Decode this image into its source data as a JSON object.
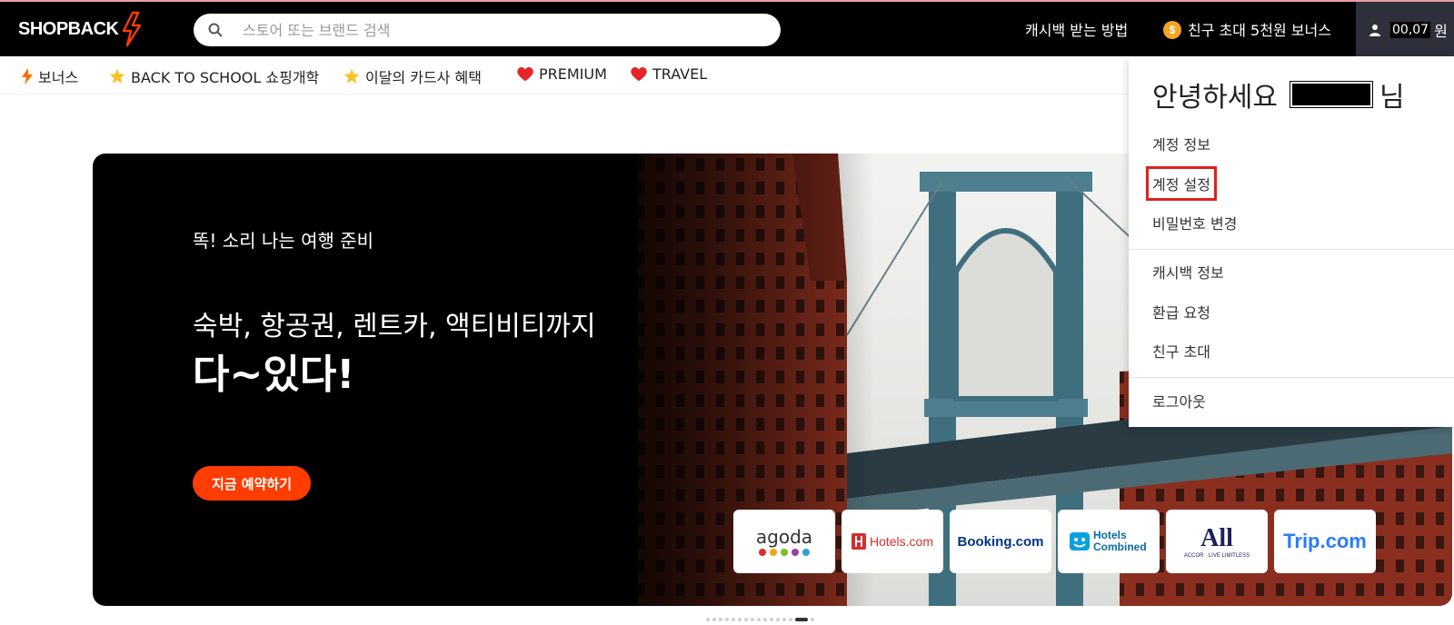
{
  "header": {
    "logo_text": "SHOPBACK",
    "search_placeholder": "스토어 또는 브랜드 검색",
    "how_to_cashback": "캐시백 받는 방법",
    "invite_bonus": "친구 초대 5천원 보너스",
    "coin_symbol": "$",
    "cashback_amount": "00,07",
    "won_unit": "원"
  },
  "subnav": {
    "items": [
      {
        "label": "보너스",
        "icon": "bolt-icon"
      },
      {
        "label": "BACK TO SCHOOL 쇼핑개학",
        "icon": "star-icon"
      },
      {
        "label": "이달의 카드사 혜택",
        "icon": "star-icon"
      },
      {
        "label": "PREMIUM",
        "icon": "heart-icon"
      },
      {
        "label": "TRAVEL",
        "icon": "heart-icon"
      }
    ]
  },
  "banner": {
    "eyebrow": "똑! 소리 나는 여행 준비",
    "line1": "숙박, 항공권, 렌트카, 액티비티까지",
    "line2": "다~있다!",
    "cta": "지금 예약하기",
    "partners": [
      {
        "name": "agoda"
      },
      {
        "name": "Hotels.com"
      },
      {
        "name": "Booking.com"
      },
      {
        "name": "Hotels Combined"
      },
      {
        "name": "All",
        "sub": "ACCOR · LIVE LIMITLESS"
      },
      {
        "name": "Trip.com"
      }
    ]
  },
  "dropdown": {
    "greeting_prefix": "안녕하세요",
    "greeting_suffix": "님",
    "items": [
      {
        "label": "계정 정보"
      },
      {
        "label": "계정 설정",
        "highlighted": true
      },
      {
        "label": "비밀번호 변경"
      },
      {
        "label": "캐시백 정보"
      },
      {
        "label": "환급 요청"
      },
      {
        "label": "친구 초대"
      },
      {
        "label": "로그아웃"
      }
    ]
  },
  "carousel": {
    "total_slides": 16,
    "active_index": 14
  },
  "colors": {
    "brand_orange": "#ff3d00",
    "highlight_red": "#e0211c",
    "heart_red": "#e5252a",
    "star_yellow": "#f7c325"
  }
}
